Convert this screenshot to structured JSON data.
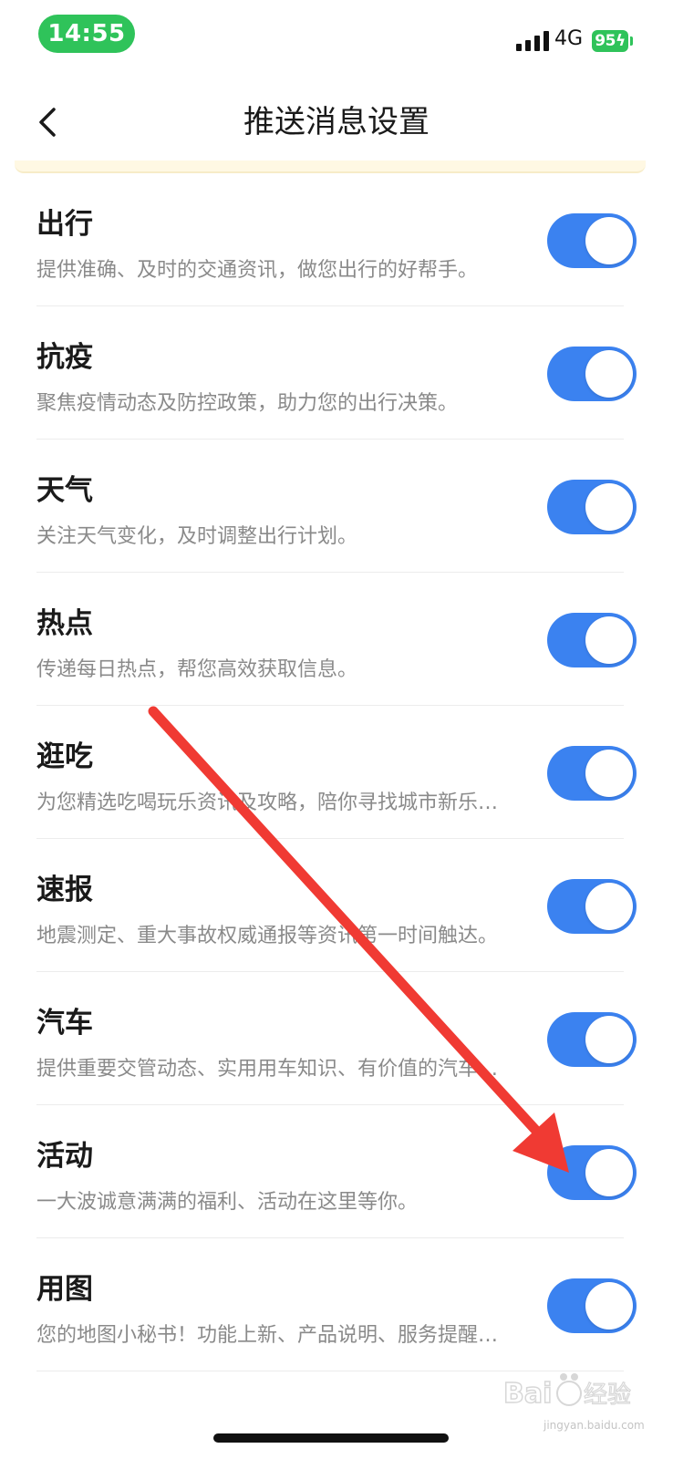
{
  "status_bar": {
    "time": "14:55",
    "network": "4G",
    "battery": "95"
  },
  "header": {
    "title": "推送消息设置"
  },
  "settings": [
    {
      "title": "出行",
      "description": "提供准确、及时的交通资讯，做您出行的好帮手。",
      "enabled": true
    },
    {
      "title": "抗疫",
      "description": "聚焦疫情动态及防控政策，助力您的出行决策。",
      "enabled": true
    },
    {
      "title": "天气",
      "description": "关注天气变化，及时调整出行计划。",
      "enabled": true
    },
    {
      "title": "热点",
      "description": "传递每日热点，帮您高效获取信息。",
      "enabled": true
    },
    {
      "title": "逛吃",
      "description": "为您精选吃喝玩乐资讯及攻略，陪你寻找城市新乐…",
      "enabled": true
    },
    {
      "title": "速报",
      "description": "地震测定、重大事故权威通报等资讯第一时间触达。",
      "enabled": true
    },
    {
      "title": "汽车",
      "description": "提供重要交管动态、实用用车知识、有价值的汽车…",
      "enabled": true
    },
    {
      "title": "活动",
      "description": "一大波诚意满满的福利、活动在这里等你。",
      "enabled": true
    },
    {
      "title": "用图",
      "description": "您的地图小秘书！功能上新、产品说明、服务提醒…",
      "enabled": true
    }
  ],
  "colors": {
    "toggle_on": "#3b82f0",
    "status_green": "#2fc35a",
    "annotation_arrow": "#f03a33"
  },
  "watermark": {
    "brand": "Baidu经验",
    "url": "jingyan.baidu.com"
  }
}
